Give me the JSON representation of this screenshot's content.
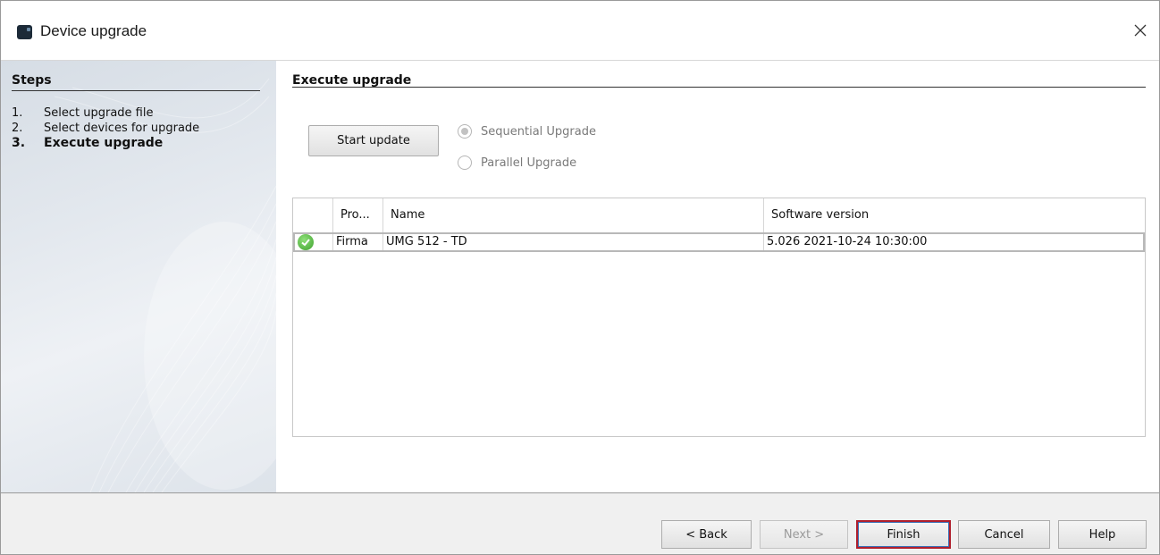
{
  "window": {
    "title": "Device upgrade",
    "icon": "app-icon",
    "close_icon": "close-icon"
  },
  "steps": {
    "title": "Steps",
    "items": [
      {
        "number": "1.",
        "label": "Select upgrade file",
        "current": false
      },
      {
        "number": "2.",
        "label": "Select devices for upgrade",
        "current": false
      },
      {
        "number": "3.",
        "label": "Execute upgrade",
        "current": true
      }
    ]
  },
  "content": {
    "title": "Execute upgrade",
    "start_button": "Start update",
    "radio_sequential": "Sequential Upgrade",
    "radio_parallel": "Parallel Upgrade",
    "selected_mode": "Sequential Upgrade"
  },
  "table": {
    "columns": [
      "",
      "Pro...",
      "Name",
      "Software version"
    ],
    "rows": [
      {
        "status_icon": "check-icon",
        "protocol": "Firma",
        "name": "UMG 512 - TD",
        "software_version": "5.026 2021-10-24 10:30:00"
      }
    ]
  },
  "footer": {
    "back": "< Back",
    "next": "Next >",
    "finish": "Finish",
    "cancel": "Cancel",
    "help": "Help"
  },
  "colors": {
    "highlight_border": "#b01e2c",
    "status_ok": "#3ea12d"
  }
}
